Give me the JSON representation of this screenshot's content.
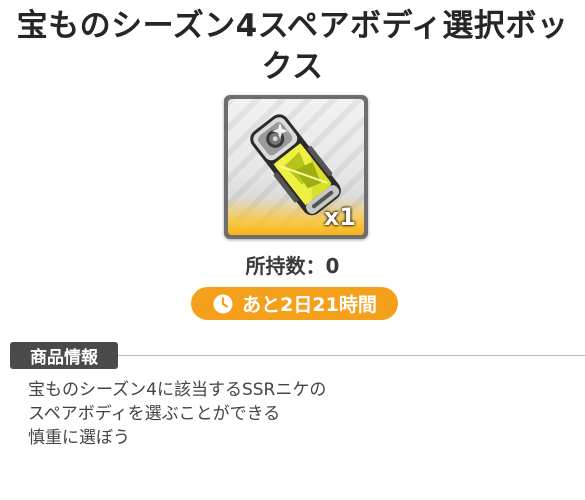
{
  "item": {
    "title": "宝ものシーズン4スペアボディ選択ボックス",
    "quantity_label": "x1",
    "icon": "spare-body-capsule-icon",
    "rarity_color": "#f7b21a"
  },
  "owned": {
    "text": "所持数：0"
  },
  "timer": {
    "icon": "clock-icon",
    "text": "あと2日21時間",
    "color": "#f5a01b"
  },
  "section": {
    "title": "商品情報"
  },
  "description": {
    "lines": [
      "宝ものシーズン4に該当するSSRニケの",
      "スペアボディを選ぶことができる",
      "慎重に選ぼう"
    ]
  }
}
